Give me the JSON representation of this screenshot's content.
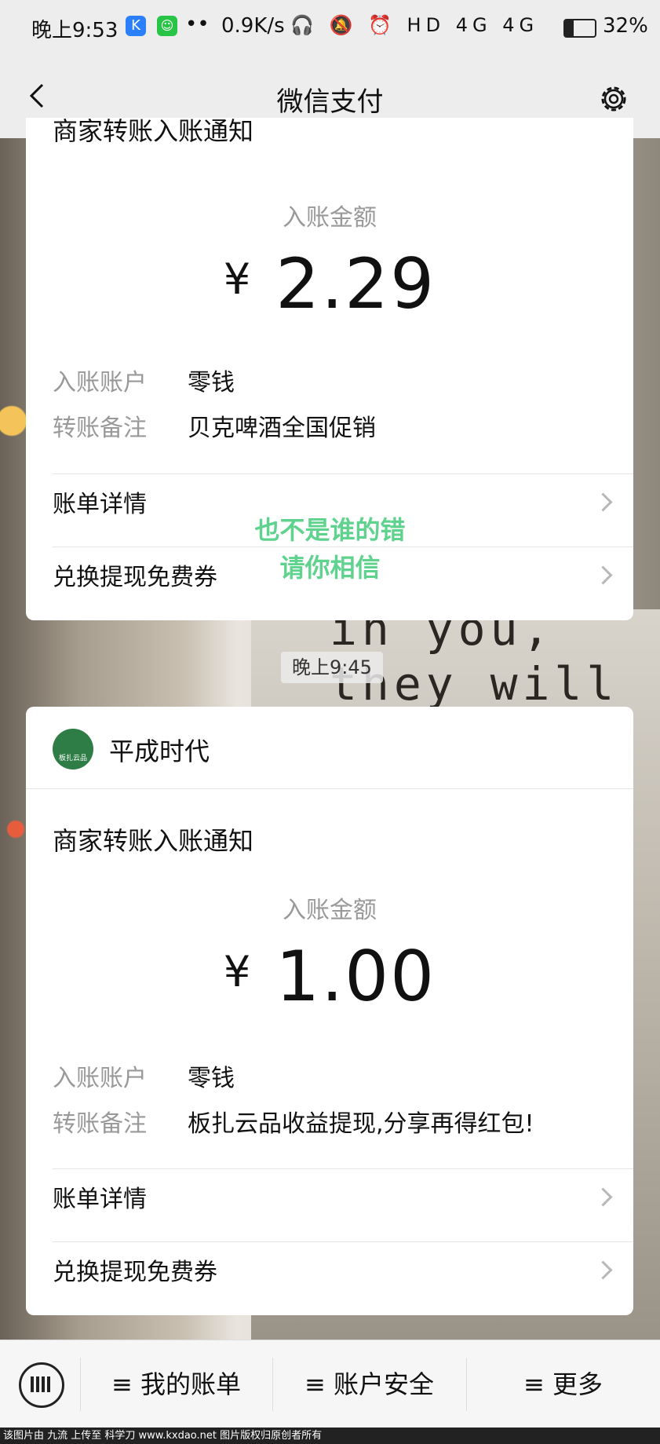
{
  "status_bar": {
    "time": "晚上9:53",
    "speed": "0.9K/s",
    "indicators": "🎧 🔕 ⏰ HD 4G 4G",
    "battery_percent": "32%"
  },
  "nav": {
    "title": "微信支付"
  },
  "card1": {
    "title": "商家转账入账通知",
    "amount_label": "入账金额",
    "currency": "¥",
    "amount": "2.29",
    "account_label": "入账账户",
    "account_value": "零钱",
    "remark_label": "转账备注",
    "remark_value": "贝克啤酒全国促销",
    "link1": "账单详情",
    "link2": "兑换提现免费券"
  },
  "overlay": {
    "line1": "也不是谁的错",
    "line2": "请你相信"
  },
  "time_chip": "晚上9:45",
  "card2": {
    "merchant": "平成时代",
    "logo_text": "板扎云品",
    "title": "商家转账入账通知",
    "amount_label": "入账金额",
    "currency": "¥",
    "amount": "1.00",
    "account_label": "入账账户",
    "account_value": "零钱",
    "remark_label": "转账备注",
    "remark_value": "板扎云品收益提现,分享再得红包!",
    "link1": "账单详情",
    "link2": "兑换提现免费券"
  },
  "bottom": {
    "menu1": "≡ 我的账单",
    "menu2": "≡ 账户安全",
    "menu3": "≡ 更多"
  },
  "background_text": "in you,\nthey will",
  "footer": "该图片由 九流 上传至 科学刀 www.kxdao.net 图片版权归原创者所有"
}
